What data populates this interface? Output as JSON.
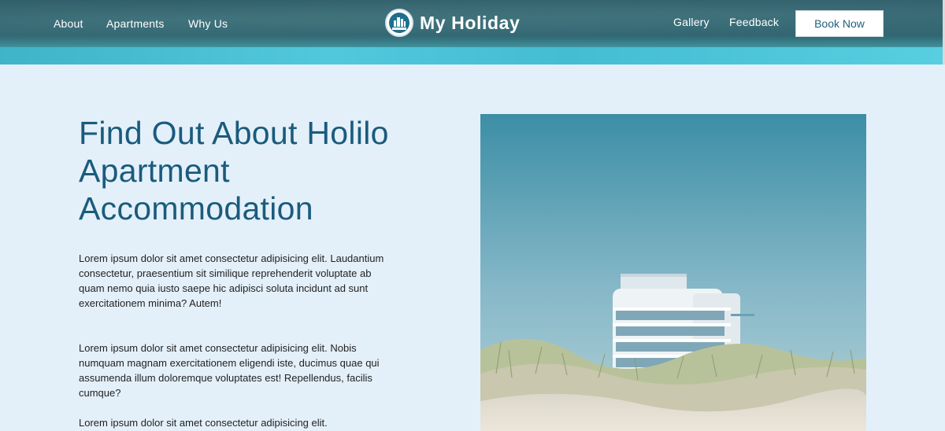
{
  "nav": {
    "left": [
      "About",
      "Apartments",
      "Why Us"
    ],
    "right": [
      "Gallery",
      "Feedback"
    ],
    "book_label": "Book Now"
  },
  "brand": {
    "title": "My Holiday"
  },
  "main": {
    "heading": "Find Out About Holilo Apartment Accommodation",
    "paragraphs": [
      "Lorem ipsum dolor sit amet consectetur adipisicing elit. Laudantium consectetur, praesentium sit similique reprehenderit voluptate ab quam nemo quia iusto saepe hic adipisci soluta incidunt ad sunt exercitationem minima? Autem!",
      "Lorem ipsum dolor sit amet consectetur adipisicing elit. Nobis numquam magnam exercitationem eligendi iste, ducimus quae qui assumenda illum doloremque voluptates est! Repellendus, facilis cumque?",
      "Lorem ipsum dolor sit amet consectetur adipisicing elit."
    ]
  },
  "colors": {
    "page_bg": "#e3f0fa",
    "heading": "#1b5b7c",
    "header_dark": "#2d5c68",
    "water": "#47c4d6"
  },
  "icons": {
    "logo": "hotel-logo-icon"
  }
}
